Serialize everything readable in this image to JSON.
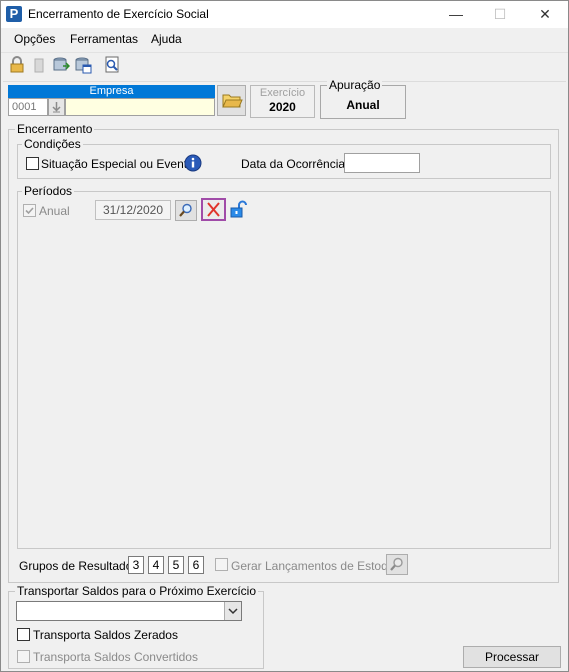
{
  "window": {
    "title": "Encerramento de Exercício Social",
    "minimize_glyph": "—",
    "maximize_glyph": "☐",
    "close_glyph": "✕"
  },
  "menu": [
    {
      "label": "Opções"
    },
    {
      "label": "Ferramentas"
    },
    {
      "label": "Ajuda"
    }
  ],
  "toolbar": {
    "icons": [
      "lock-icon",
      "trash-icon",
      "database-export-icon",
      "database-calendar-icon",
      "preview-icon"
    ]
  },
  "empresa": {
    "header": "Empresa",
    "code": "0001",
    "name": ""
  },
  "exercicio": {
    "label": "Exercício",
    "value": "2020"
  },
  "apuracao": {
    "label": "Apuração",
    "value": "Anual"
  },
  "encerramento": {
    "label": "Encerramento",
    "condicoes": {
      "label": "Condições",
      "situacao_label": "Situação Especial ou Evento",
      "data_ocorrencia_label": "Data da Ocorrência:",
      "data_ocorrencia_value": ""
    },
    "periodos": {
      "label": "Períodos",
      "anual_label": "Anual",
      "anual_checked": true,
      "date_value": "31/12/2020"
    }
  },
  "grupos": {
    "label": "Grupos de Resultado:",
    "values": [
      "3",
      "4",
      "5",
      "6"
    ],
    "estoque_label": "Gerar Lançamentos de Estoque"
  },
  "transportar": {
    "label": "Transportar Saldos para o Próximo Exercício",
    "combo_value": "",
    "zerados_label": "Transporta Saldos Zerados",
    "convertidos_label": "Transporta Saldos Convertidos"
  },
  "processar_label": "Processar",
  "colors": {
    "accent": "#0078d7",
    "highlight_border": "#a04ba8",
    "delete_red": "#e0342c"
  }
}
